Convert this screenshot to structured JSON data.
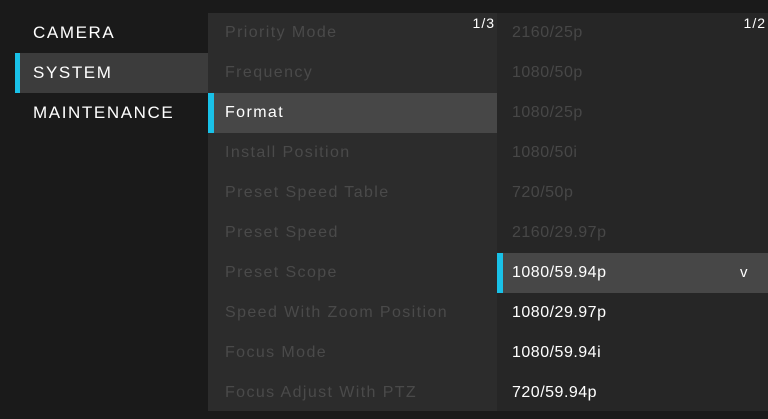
{
  "main_menu": {
    "items": [
      {
        "label": "CAMERA"
      },
      {
        "label": "SYSTEM"
      },
      {
        "label": "MAINTENANCE"
      }
    ]
  },
  "system_menu": {
    "page_indicator": "1/3",
    "items": [
      {
        "label": "Priority Mode"
      },
      {
        "label": "Frequency"
      },
      {
        "label": "Format"
      },
      {
        "label": "Install Position"
      },
      {
        "label": "Preset Speed Table"
      },
      {
        "label": "Preset Speed"
      },
      {
        "label": "Preset Scope"
      },
      {
        "label": "Speed With Zoom Position"
      },
      {
        "label": "Focus Mode"
      },
      {
        "label": "Focus Adjust With PTZ"
      }
    ]
  },
  "format_options": {
    "page_indicator": "1/2",
    "items": [
      {
        "label": "2160/25p"
      },
      {
        "label": "1080/50p"
      },
      {
        "label": "1080/25p"
      },
      {
        "label": "1080/50i"
      },
      {
        "label": "720/50p"
      },
      {
        "label": "2160/29.97p"
      },
      {
        "label": "1080/59.94p",
        "mark": "v"
      },
      {
        "label": "1080/29.97p"
      },
      {
        "label": "1080/59.94i"
      },
      {
        "label": "720/59.94p"
      }
    ]
  },
  "colors": {
    "accent": "#19c1e8",
    "highlight": "#474747",
    "disabled_text": "#4a4a4a",
    "text": "#ffffff"
  }
}
